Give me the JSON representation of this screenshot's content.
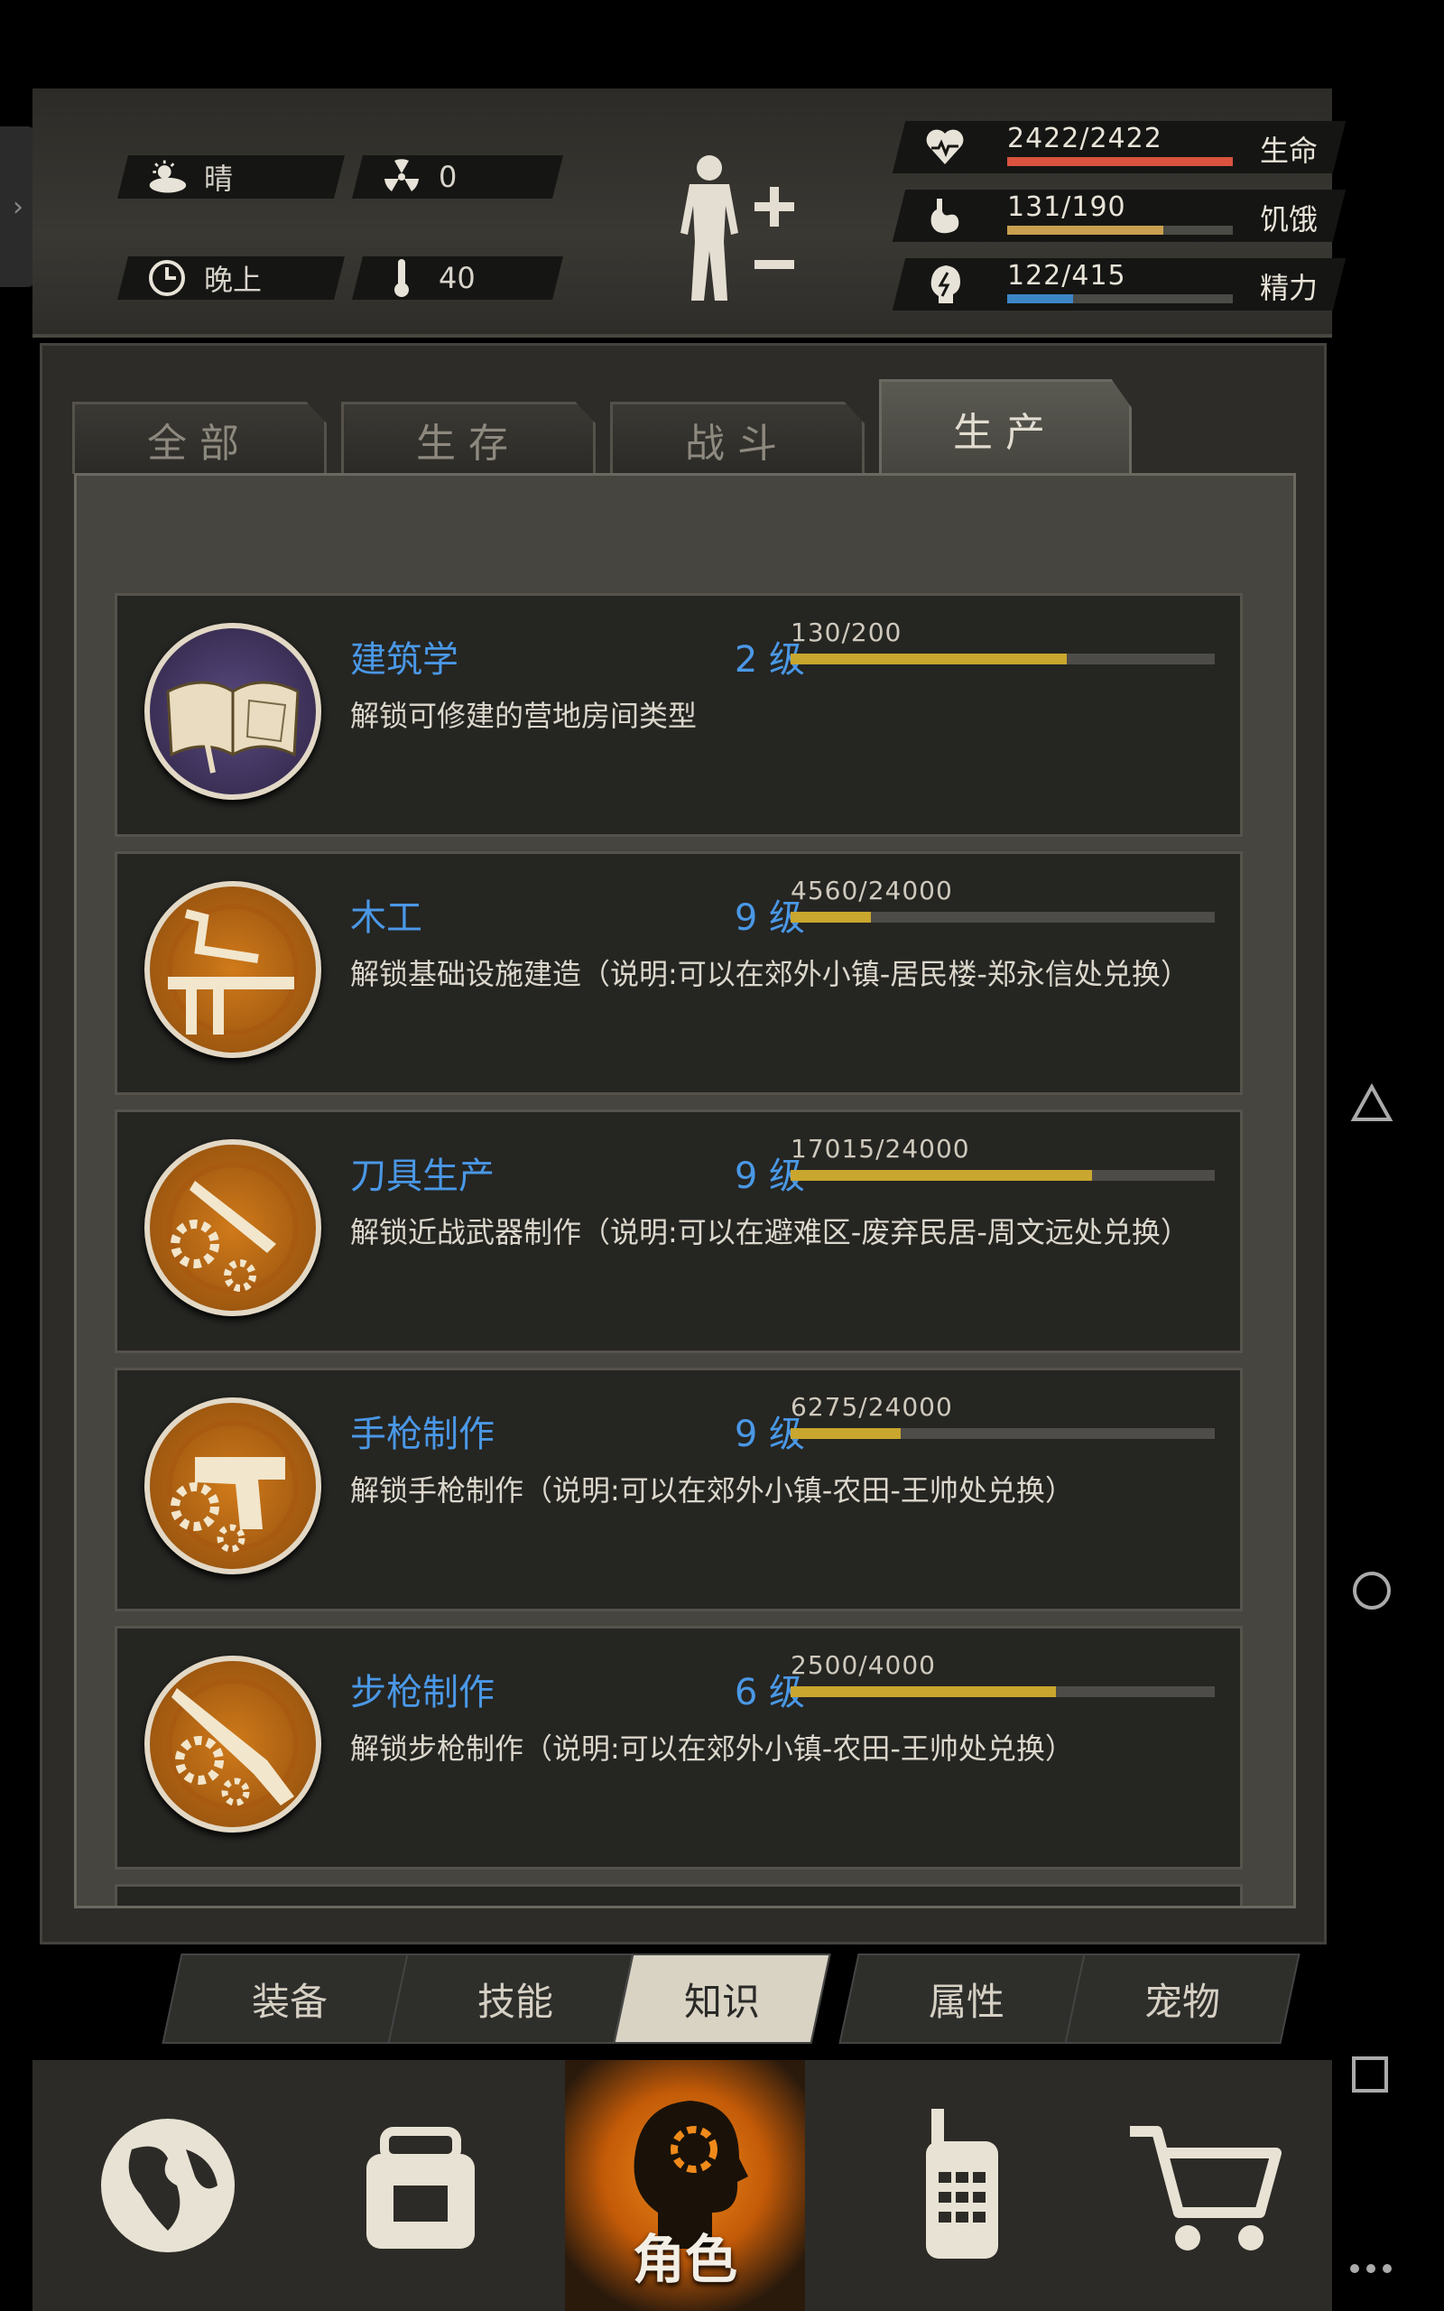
{
  "hud": {
    "weather": "晴",
    "radiation": "0",
    "time_of_day": "晚上",
    "temperature": "40",
    "stats": [
      {
        "value": "2422/2422",
        "name": "生命",
        "fill": 1.0,
        "color": "#d9533f"
      },
      {
        "value": "131/190",
        "name": "饥饿",
        "fill": 0.69,
        "color": "#c9a050"
      },
      {
        "value": "122/415",
        "name": "精力",
        "fill": 0.29,
        "color": "#3d86c6"
      }
    ]
  },
  "category_tabs": [
    "全部",
    "生存",
    "战斗",
    "生产"
  ],
  "active_category": "生产",
  "skills": [
    {
      "title": "建筑学",
      "level": "2 级",
      "progress": "130/200",
      "fraction": 0.65,
      "desc": "解锁可修建的营地房间类型",
      "icon": "book-icon"
    },
    {
      "title": "木工",
      "level": "9 级",
      "progress": "4560/24000",
      "fraction": 0.19,
      "desc": "解锁基础设施建造（说明:可以在郊外小镇-居民楼-郑永信处兑换）",
      "icon": "carpentry-icon"
    },
    {
      "title": "刀具生产",
      "level": "9 级",
      "progress": "17015/24000",
      "fraction": 0.71,
      "desc": "解锁近战武器制作（说明:可以在避难区-废弃民居-周文远处兑换）",
      "icon": "knife-icon"
    },
    {
      "title": "手枪制作",
      "level": "9 级",
      "progress": "6275/24000",
      "fraction": 0.26,
      "desc": "解锁手枪制作（说明:可以在郊外小镇-农田-王帅处兑换）",
      "icon": "pistol-icon"
    },
    {
      "title": "步枪制作",
      "level": "6 级",
      "progress": "2500/4000",
      "fraction": 0.625,
      "desc": "解锁步枪制作（说明:可以在郊外小镇-农田-王帅处兑换）",
      "icon": "rifle-icon"
    }
  ],
  "sub_tabs": [
    "装备",
    "技能",
    "知识",
    "属性",
    "宠物"
  ],
  "active_sub_tab": "知识",
  "bottom_nav": {
    "active_label": "角色",
    "items": [
      "globe-icon",
      "backpack-icon",
      "character-icon",
      "radio-icon",
      "cart-icon"
    ]
  }
}
